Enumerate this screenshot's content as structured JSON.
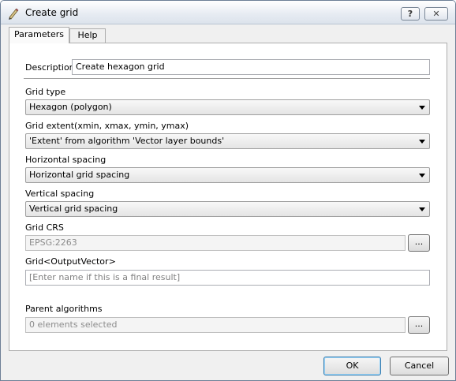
{
  "window": {
    "title": "Create grid",
    "help_button": "?",
    "close_button": "✕"
  },
  "tabs": [
    {
      "label": "Parameters",
      "active": true
    },
    {
      "label": "Help",
      "active": false
    }
  ],
  "form": {
    "description_label": "Description",
    "description_value": "Create hexagon grid",
    "grid_type_label": "Grid type",
    "grid_type_value": "Hexagon (polygon)",
    "grid_extent_label": "Grid extent(xmin, xmax, ymin, ymax)",
    "grid_extent_value": "'Extent' from algorithm 'Vector layer bounds'",
    "horizontal_spacing_label": "Horizontal spacing",
    "horizontal_spacing_value": "Horizontal grid spacing",
    "vertical_spacing_label": "Vertical spacing",
    "vertical_spacing_value": "Vertical grid spacing",
    "grid_crs_label": "Grid CRS",
    "grid_crs_value": "EPSG:2263",
    "grid_crs_button": "...",
    "output_label": "Grid<OutputVector>",
    "output_placeholder": "[Enter name if this is a final result]",
    "parent_algorithms_label": "Parent algorithms",
    "parent_algorithms_value": "0 elements selected",
    "parent_algorithms_button": "..."
  },
  "footer": {
    "ok_label": "OK",
    "cancel_label": "Cancel"
  },
  "icons": {
    "app_icon": "pencil-icon",
    "dropdown": "chevron-down-icon"
  }
}
